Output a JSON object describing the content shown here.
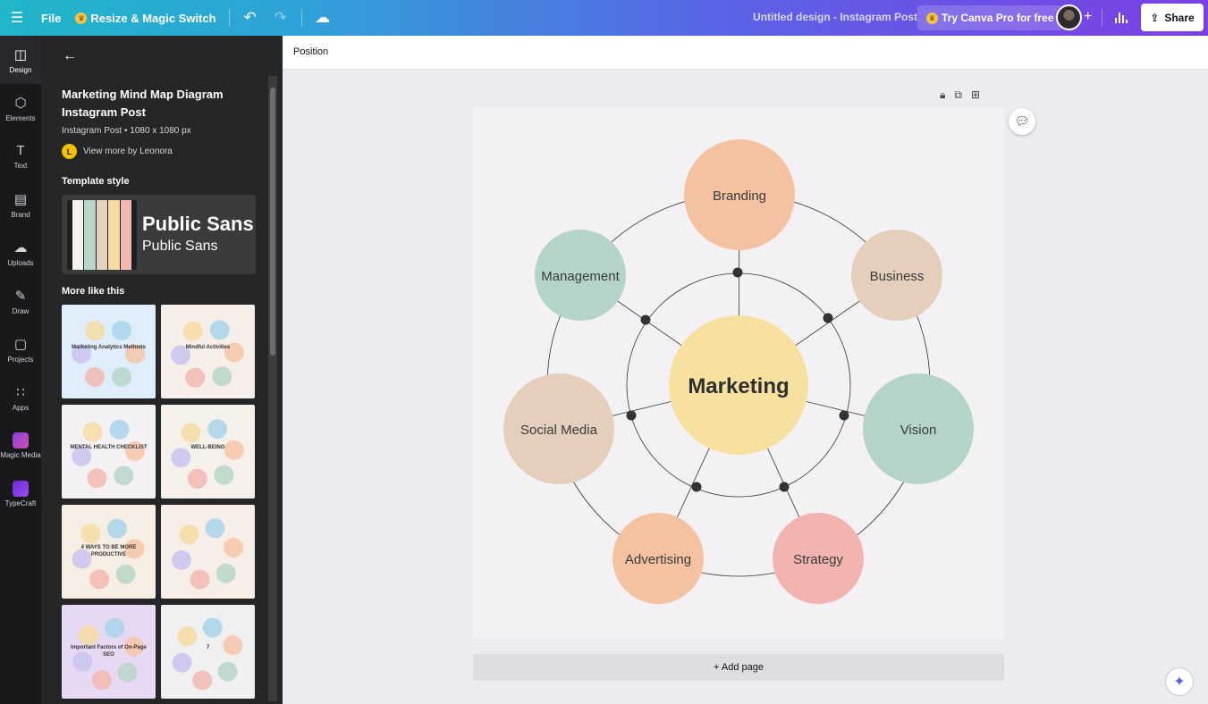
{
  "topbar": {
    "file": "File",
    "resize": "Resize & Magic Switch",
    "title": "Untitled design - Instagram Post",
    "try_pro": "Try Canva Pro for free",
    "share": "Share"
  },
  "rail": [
    {
      "label": "Design",
      "icon": "◫"
    },
    {
      "label": "Elements",
      "icon": "⬡"
    },
    {
      "label": "Text",
      "icon": "T"
    },
    {
      "label": "Brand",
      "icon": "▤"
    },
    {
      "label": "Uploads",
      "icon": "☁"
    },
    {
      "label": "Draw",
      "icon": "✎"
    },
    {
      "label": "Projects",
      "icon": "▢"
    },
    {
      "label": "Apps",
      "icon": "∷"
    },
    {
      "label": "Magic Media",
      "icon": ""
    },
    {
      "label": "TypeCraft",
      "icon": ""
    }
  ],
  "panel": {
    "template_title": "Marketing Mind Map Diagram Instagram Post",
    "template_meta": "Instagram Post • 1080 x 1080 px",
    "author_initial": "L",
    "author_link": "View more by Leonora",
    "template_style_heading": "Template style",
    "font_heading": "Public Sans",
    "font_body": "Public Sans",
    "swatch_colors": [
      "#f6f3ef",
      "#b9d5c8",
      "#e5d3bf",
      "#f6dca3",
      "#f2b8b2"
    ],
    "more_like_this": "More like this",
    "thumbnails": [
      {
        "name": "thumb-marketing-analytics",
        "bg": "#dfeefa",
        "label": "Marketing Analytics Methods"
      },
      {
        "name": "thumb-mindful-activities",
        "bg": "#f6efe9",
        "label": "Mindful Activities"
      },
      {
        "name": "thumb-mental-health",
        "bg": "#f4f1f4",
        "label": "MENTAL HEALTH CHECKLIST"
      },
      {
        "name": "thumb-well-being",
        "bg": "#f5f1ea",
        "label": "WELL-BEING"
      },
      {
        "name": "thumb-productive",
        "bg": "#f6eee2",
        "label": "4 WAYS TO BE MORE PRODUCTIVE"
      },
      {
        "name": "thumb-circle-segments",
        "bg": "#f7efe7",
        "label": ""
      },
      {
        "name": "thumb-seo-factors",
        "bg": "#e7d9f3",
        "label": "Important Factors of On-Page SEO"
      },
      {
        "name": "thumb-seven-steps",
        "bg": "#eff0ef",
        "label": "7"
      }
    ]
  },
  "editor": {
    "position": "Position",
    "add_page": "+ Add page"
  },
  "mindmap": {
    "center": {
      "label": "Marketing",
      "color": "#f7e1a1"
    },
    "nodes": [
      {
        "id": "branding",
        "label": "Branding",
        "color": "#f4c2a1"
      },
      {
        "id": "business",
        "label": "Business",
        "color": "#e3cfbc"
      },
      {
        "id": "vision",
        "label": "Vision",
        "color": "#b4d4c8"
      },
      {
        "id": "strategy",
        "label": "Strategy",
        "color": "#f1b4b1"
      },
      {
        "id": "advertising",
        "label": "Advertising",
        "color": "#f4c2a1"
      },
      {
        "id": "social-media",
        "label": "Social Media",
        "color": "#e3cfbc"
      },
      {
        "id": "management",
        "label": "Management",
        "color": "#b4d4c8"
      }
    ]
  }
}
